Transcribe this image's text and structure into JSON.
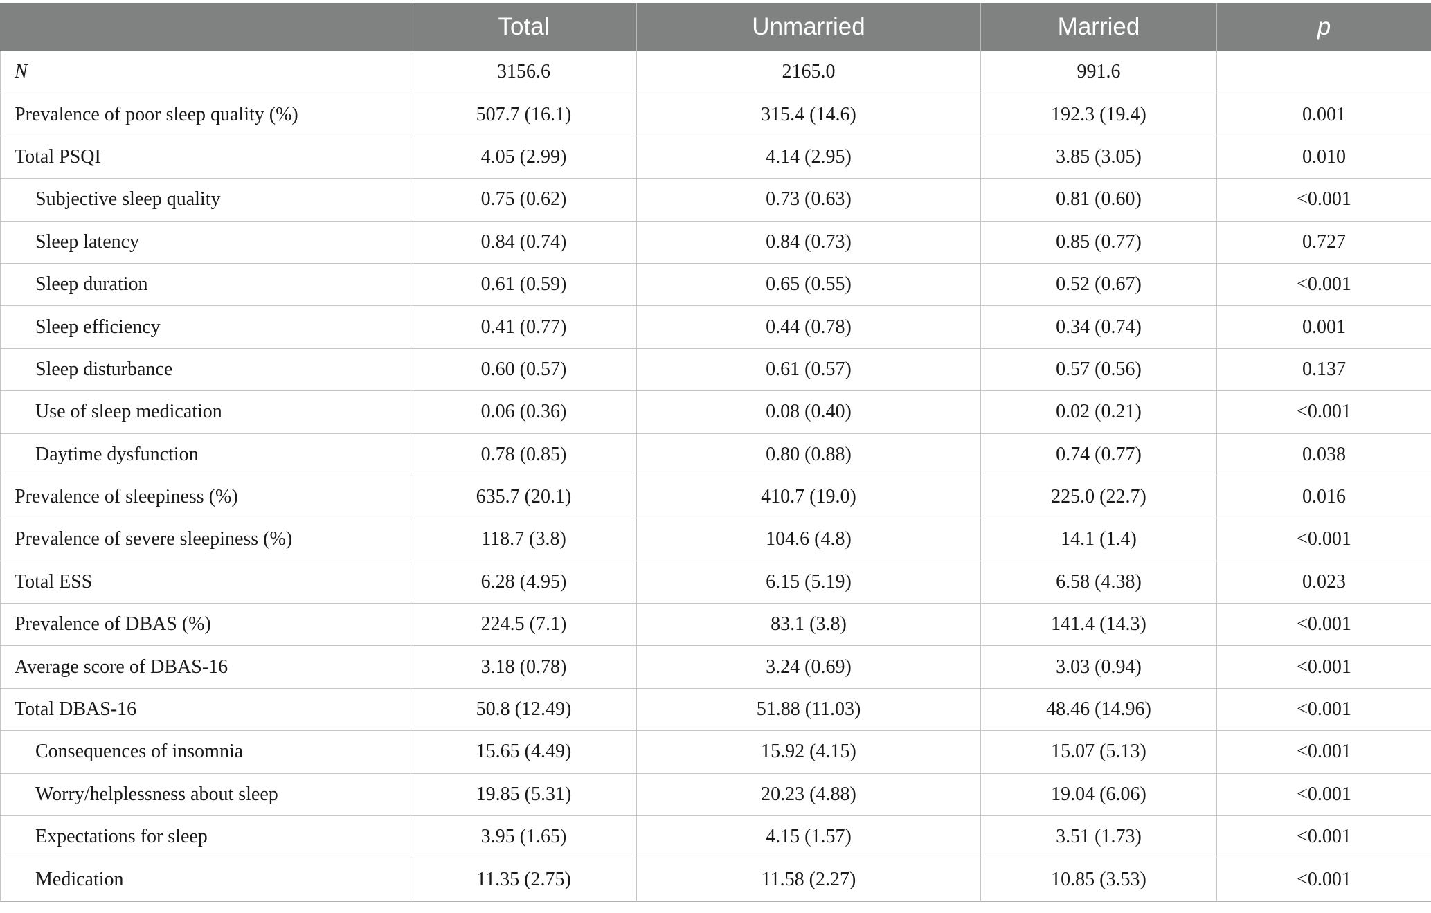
{
  "table": {
    "headers": [
      "",
      "Total",
      "Unmarried",
      "Married",
      "p"
    ],
    "rows": [
      {
        "label": "N",
        "indent": false,
        "italic": true,
        "total": "3156.6",
        "unmarried": "2165.0",
        "married": "991.6",
        "p": ""
      },
      {
        "label": "Prevalence of poor sleep quality (%)",
        "indent": false,
        "italic": false,
        "total": "507.7 (16.1)",
        "unmarried": "315.4 (14.6)",
        "married": "192.3 (19.4)",
        "p": "0.001"
      },
      {
        "label": "Total PSQI",
        "indent": false,
        "italic": false,
        "total": "4.05 (2.99)",
        "unmarried": "4.14 (2.95)",
        "married": "3.85 (3.05)",
        "p": "0.010"
      },
      {
        "label": "Subjective sleep quality",
        "indent": true,
        "italic": false,
        "total": "0.75 (0.62)",
        "unmarried": "0.73 (0.63)",
        "married": "0.81 (0.60)",
        "p": "<0.001"
      },
      {
        "label": "Sleep latency",
        "indent": true,
        "italic": false,
        "total": "0.84 (0.74)",
        "unmarried": "0.84 (0.73)",
        "married": "0.85 (0.77)",
        "p": "0.727"
      },
      {
        "label": "Sleep duration",
        "indent": true,
        "italic": false,
        "total": "0.61 (0.59)",
        "unmarried": "0.65 (0.55)",
        "married": "0.52 (0.67)",
        "p": "<0.001"
      },
      {
        "label": "Sleep efficiency",
        "indent": true,
        "italic": false,
        "total": "0.41 (0.77)",
        "unmarried": "0.44 (0.78)",
        "married": "0.34 (0.74)",
        "p": "0.001"
      },
      {
        "label": "Sleep disturbance",
        "indent": true,
        "italic": false,
        "total": "0.60 (0.57)",
        "unmarried": "0.61 (0.57)",
        "married": "0.57 (0.56)",
        "p": "0.137"
      },
      {
        "label": "Use of sleep medication",
        "indent": true,
        "italic": false,
        "total": "0.06 (0.36)",
        "unmarried": "0.08 (0.40)",
        "married": "0.02 (0.21)",
        "p": "<0.001"
      },
      {
        "label": "Daytime dysfunction",
        "indent": true,
        "italic": false,
        "total": "0.78 (0.85)",
        "unmarried": "0.80 (0.88)",
        "married": "0.74 (0.77)",
        "p": "0.038"
      },
      {
        "label": "Prevalence of sleepiness (%)",
        "indent": false,
        "italic": false,
        "total": "635.7 (20.1)",
        "unmarried": "410.7 (19.0)",
        "married": "225.0 (22.7)",
        "p": "0.016"
      },
      {
        "label": "Prevalence of severe sleepiness (%)",
        "indent": false,
        "italic": false,
        "total": "118.7 (3.8)",
        "unmarried": "104.6 (4.8)",
        "married": "14.1 (1.4)",
        "p": "<0.001"
      },
      {
        "label": "Total ESS",
        "indent": false,
        "italic": false,
        "total": "6.28 (4.95)",
        "unmarried": "6.15 (5.19)",
        "married": "6.58 (4.38)",
        "p": "0.023"
      },
      {
        "label": "Prevalence of DBAS (%)",
        "indent": false,
        "italic": false,
        "total": "224.5 (7.1)",
        "unmarried": "83.1 (3.8)",
        "married": "141.4 (14.3)",
        "p": "<0.001"
      },
      {
        "label": "Average score of DBAS-16",
        "indent": false,
        "italic": false,
        "total": "3.18 (0.78)",
        "unmarried": "3.24 (0.69)",
        "married": "3.03 (0.94)",
        "p": "<0.001"
      },
      {
        "label": "Total DBAS-16",
        "indent": false,
        "italic": false,
        "total": "50.8 (12.49)",
        "unmarried": "51.88 (11.03)",
        "married": "48.46 (14.96)",
        "p": "<0.001"
      },
      {
        "label": "Consequences of insomnia",
        "indent": true,
        "italic": false,
        "total": "15.65 (4.49)",
        "unmarried": "15.92 (4.15)",
        "married": "15.07 (5.13)",
        "p": "<0.001"
      },
      {
        "label": "Worry/helplessness about sleep",
        "indent": true,
        "italic": false,
        "total": "19.85 (5.31)",
        "unmarried": "20.23 (4.88)",
        "married": "19.04 (6.06)",
        "p": "<0.001"
      },
      {
        "label": "Expectations for sleep",
        "indent": true,
        "italic": false,
        "total": "3.95 (1.65)",
        "unmarried": "4.15 (1.57)",
        "married": "3.51 (1.73)",
        "p": "<0.001"
      },
      {
        "label": "Medication",
        "indent": true,
        "italic": false,
        "total": "11.35 (2.75)",
        "unmarried": "11.58 (2.27)",
        "married": "10.85 (3.53)",
        "p": "<0.001"
      }
    ]
  }
}
